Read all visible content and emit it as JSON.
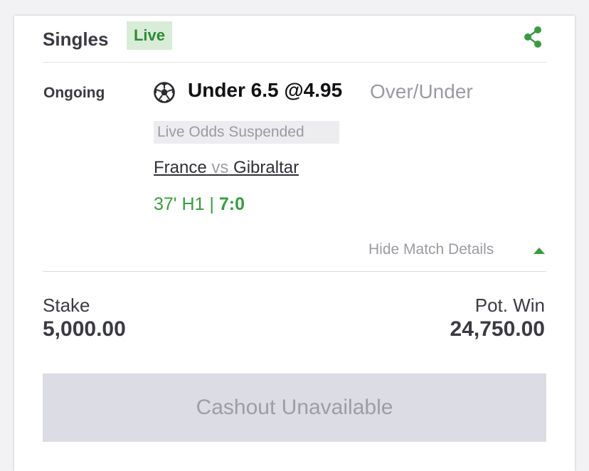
{
  "header": {
    "title": "Singles",
    "badge": "Live",
    "share_icon": "share-icon"
  },
  "bet": {
    "status": "Ongoing",
    "sport_icon": "soccer-ball-icon",
    "selection": "Under 6.5 @4.95",
    "market": "Over/Under",
    "notice": "Live Odds Suspended",
    "home_team": "France",
    "vs": "vs",
    "away_team": "Gibraltar",
    "match_time": "37' H1 | ",
    "score": "7:0",
    "toggle_label": "Hide Match Details",
    "toggle_icon": "caret-up-icon"
  },
  "totals": {
    "stake_label": "Stake",
    "stake_value": "5,000.00",
    "win_label": "Pot. Win",
    "win_value": "24,750.00"
  },
  "cashout": {
    "label": "Cashout Unavailable"
  },
  "colors": {
    "accent_green": "#3a9a40",
    "badge_bg": "#d8ecd8",
    "muted_text": "#9a9aa2",
    "disabled_button": "#dcdce4"
  }
}
